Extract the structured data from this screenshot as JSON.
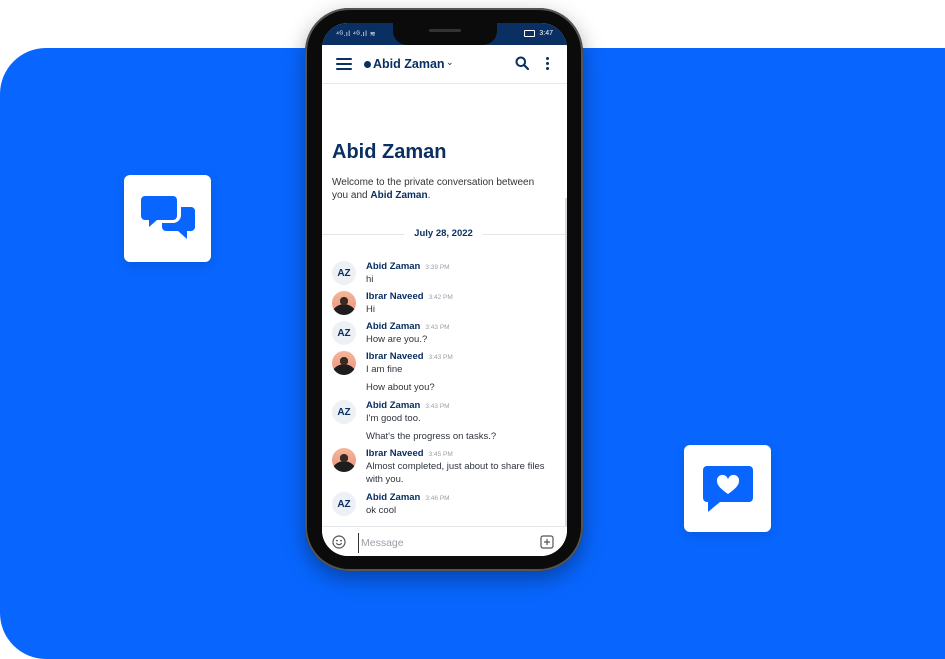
{
  "status_bar": {
    "signal": "⁴ᴳ.ıl ⁴ᴳ.ıl ≋",
    "time": "3:47"
  },
  "header": {
    "title": "Abid Zaman",
    "caret": "⌄"
  },
  "intro": {
    "title": "Abid Zaman",
    "text_prefix": "Welcome to the private conversation between you and ",
    "text_name": "Abid Zaman",
    "text_suffix": "."
  },
  "date_separator": "July 28, 2022",
  "messages": [
    {
      "avatar": "AZ",
      "name": "Abid Zaman",
      "time": "3:39 PM",
      "lines": [
        "hi"
      ]
    },
    {
      "avatar": "photo",
      "name": "Ibrar Naveed",
      "time": "3:42 PM",
      "lines": [
        "Hi"
      ]
    },
    {
      "avatar": "AZ",
      "name": "Abid Zaman",
      "time": "3:43 PM",
      "lines": [
        "How are you.?"
      ]
    },
    {
      "avatar": "photo",
      "name": "Ibrar Naveed",
      "time": "3:43 PM",
      "lines": [
        "I am fine",
        "How about you?"
      ]
    },
    {
      "avatar": "AZ",
      "name": "Abid Zaman",
      "time": "3:43 PM",
      "lines": [
        "I'm good too.",
        "What's the progress on tasks.?"
      ]
    },
    {
      "avatar": "photo",
      "name": "Ibrar Naveed",
      "time": "3:45 PM",
      "lines": [
        "Almost completed, just about to share files with you."
      ]
    },
    {
      "avatar": "AZ",
      "name": "Abid Zaman",
      "time": "3:46 PM",
      "lines": [
        "ok cool"
      ]
    }
  ],
  "composer": {
    "placeholder": "Message"
  },
  "icons": {
    "left_tile": "chat-bubbles-icon",
    "right_tile": "heart-message-icon",
    "emoji": "smile-icon",
    "attach": "plus-square-icon",
    "menu": "hamburger-icon",
    "search": "search-icon",
    "more": "kebab-icon"
  },
  "colors": {
    "brand_blue": "#0866ff",
    "navy": "#0a2f62"
  }
}
